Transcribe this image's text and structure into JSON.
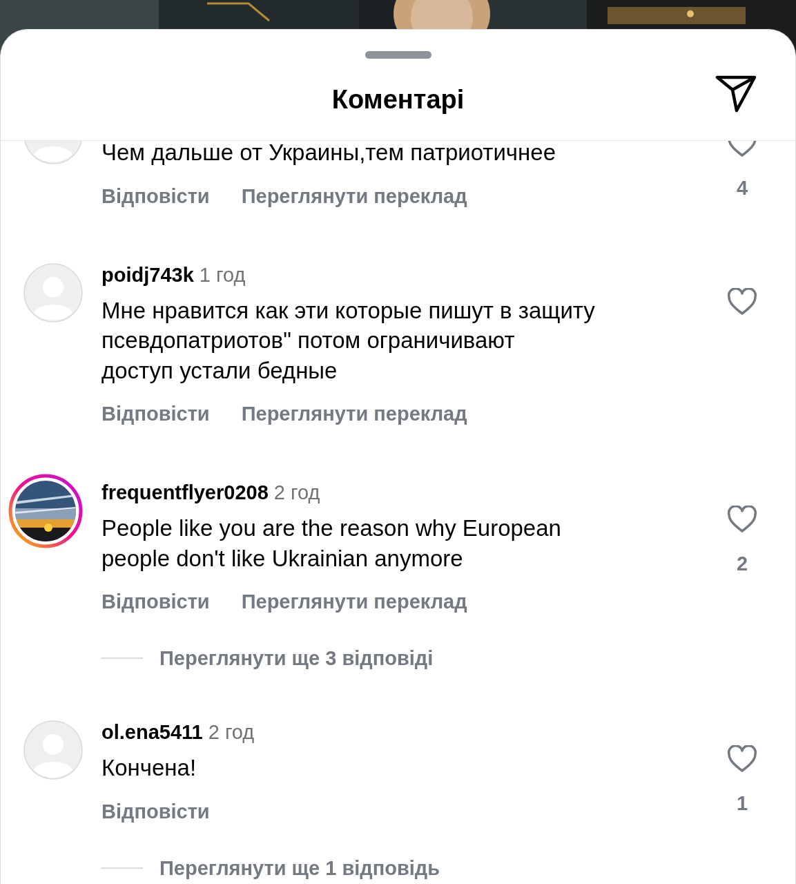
{
  "sheet": {
    "title": "Коментарі"
  },
  "comments": [
    {
      "kind": "plain",
      "text": "Чем дальше от Украины,тем патриотичнее",
      "actions": [
        "Відповісти",
        "Переглянути переклад"
      ],
      "likes": "4"
    },
    {
      "kind": "plain",
      "username": "poidj743k",
      "time": "1 год",
      "text": "Мне нравится как эти которые пишут в защиту\nпсевдопатриотов\" потом ограничивают\nдоступ устали бедные",
      "actions": [
        "Відповісти",
        "Переглянути переклад"
      ]
    },
    {
      "kind": "story",
      "username": "frequentflyer0208",
      "time": "2 год",
      "text": "People like you are the reason why European\npeople don't like Ukrainian anymore",
      "actions": [
        "Відповісти",
        "Переглянути переклад"
      ],
      "likes": "2",
      "replies": "Переглянути ще 3 відповіді"
    },
    {
      "kind": "plain",
      "username": "ol.ena5411",
      "time": "2 год",
      "text": "Кончена!",
      "actions": [
        "Відповісти"
      ],
      "likes": "1",
      "replies": "Переглянути ще 1 відповідь"
    }
  ]
}
